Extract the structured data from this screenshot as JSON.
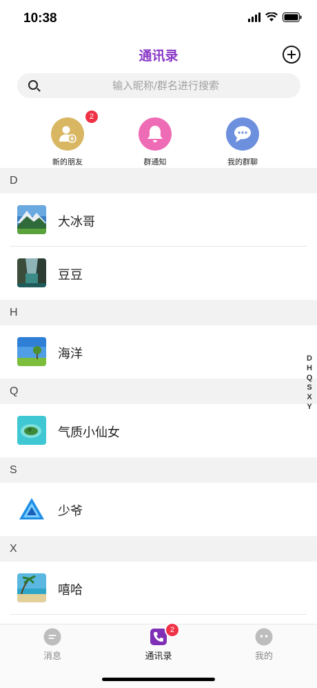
{
  "status_bar": {
    "time": "10:38"
  },
  "header": {
    "title": "通讯录"
  },
  "search": {
    "placeholder": "输入昵称/群名进行搜索"
  },
  "quick_actions": [
    {
      "label": "新的朋友",
      "badge": "2",
      "color": "#d9b762",
      "icon": "add-friend-icon"
    },
    {
      "label": "群通知",
      "color": "#ee6bb6",
      "icon": "bell-icon"
    },
    {
      "label": "我的群聊",
      "color": "#6c8fde",
      "icon": "chat-bubble-icon"
    }
  ],
  "sections": [
    {
      "letter": "D",
      "contacts": [
        {
          "name": "大冰哥",
          "avatar": "mountain-landscape"
        },
        {
          "name": "豆豆",
          "avatar": "river-valley"
        }
      ]
    },
    {
      "letter": "H",
      "contacts": [
        {
          "name": "海洋",
          "avatar": "tree-field"
        }
      ]
    },
    {
      "letter": "Q",
      "contacts": [
        {
          "name": "气质小仙女",
          "avatar": "tropical-island"
        }
      ]
    },
    {
      "letter": "S",
      "contacts": [
        {
          "name": "少爷",
          "avatar": "blue-triangle-logo"
        }
      ]
    },
    {
      "letter": "X",
      "contacts": [
        {
          "name": "嘻哈",
          "avatar": "beach-palm"
        }
      ]
    }
  ],
  "index_bar": [
    "D",
    "H",
    "Q",
    "S",
    "X",
    "Y"
  ],
  "tab_bar": {
    "tabs": [
      {
        "label": "消息",
        "icon": "message-icon",
        "active": false
      },
      {
        "label": "通讯录",
        "icon": "contacts-phone-icon",
        "active": true,
        "badge": "2"
      },
      {
        "label": "我的",
        "icon": "profile-face-icon",
        "active": false
      }
    ]
  },
  "colors": {
    "accent": "#8a39c6",
    "badge": "#f03246",
    "section_bg": "#f2f2f2"
  }
}
